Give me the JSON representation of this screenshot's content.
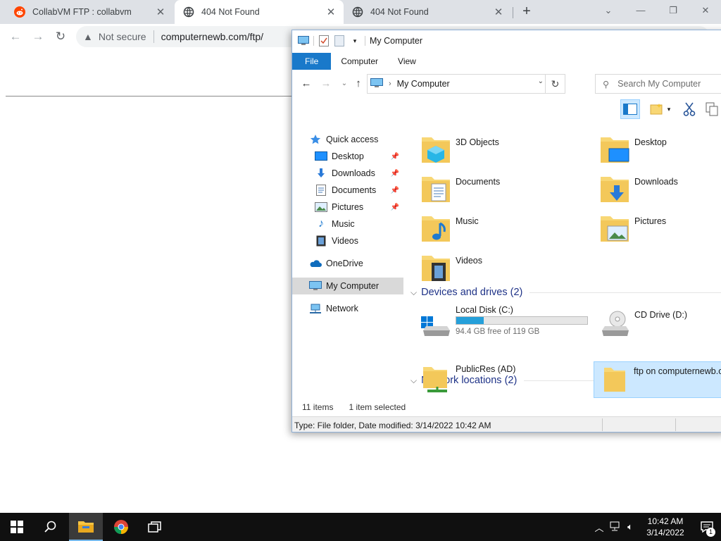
{
  "browser": {
    "tabs": [
      {
        "title": "CollabVM FTP : collabvm",
        "active": false
      },
      {
        "title": "404 Not Found",
        "active": true
      },
      {
        "title": "404 Not Found",
        "active": false
      }
    ],
    "new_tab": "+",
    "security_label": "Not secure",
    "url": "computernewb.com/ftp/"
  },
  "explorer": {
    "title": "My Computer",
    "ribbon_tabs": [
      "File",
      "Computer",
      "View"
    ],
    "address": "My Computer",
    "search_placeholder": "Search My Computer",
    "nav": {
      "quick_access": "Quick access",
      "quick_items": [
        "Desktop",
        "Downloads",
        "Documents",
        "Pictures",
        "Music",
        "Videos"
      ],
      "onedrive": "OneDrive",
      "this_pc": "My Computer",
      "network": "Network"
    },
    "folders": [
      "3D Objects",
      "Desktop",
      "Documents",
      "Downloads",
      "Music",
      "Pictures",
      "Videos"
    ],
    "devices_header": "Devices and drives (2)",
    "drives": [
      {
        "name": "Local Disk (C:)",
        "free": "94.4 GB free of 119 GB",
        "used_fraction": 0.21
      },
      {
        "name": "CD Drive (D:)"
      }
    ],
    "network_header": "Network locations (2)",
    "network_locations": [
      "PublicRes (AD)",
      "ftp on computernewb.c"
    ],
    "status": {
      "items": "11 items",
      "selected": "1 item selected"
    },
    "details": "Type: File folder, Date modified: 3/14/2022 10:42 AM"
  },
  "taskbar": {
    "time": "10:42 AM",
    "date": "3/14/2022",
    "notification_count": "1"
  },
  "colors": {
    "accent": "#1979ca",
    "selection": "#cce8ff",
    "drive_fill": "#26a0da",
    "group_header": "#1e3287"
  }
}
